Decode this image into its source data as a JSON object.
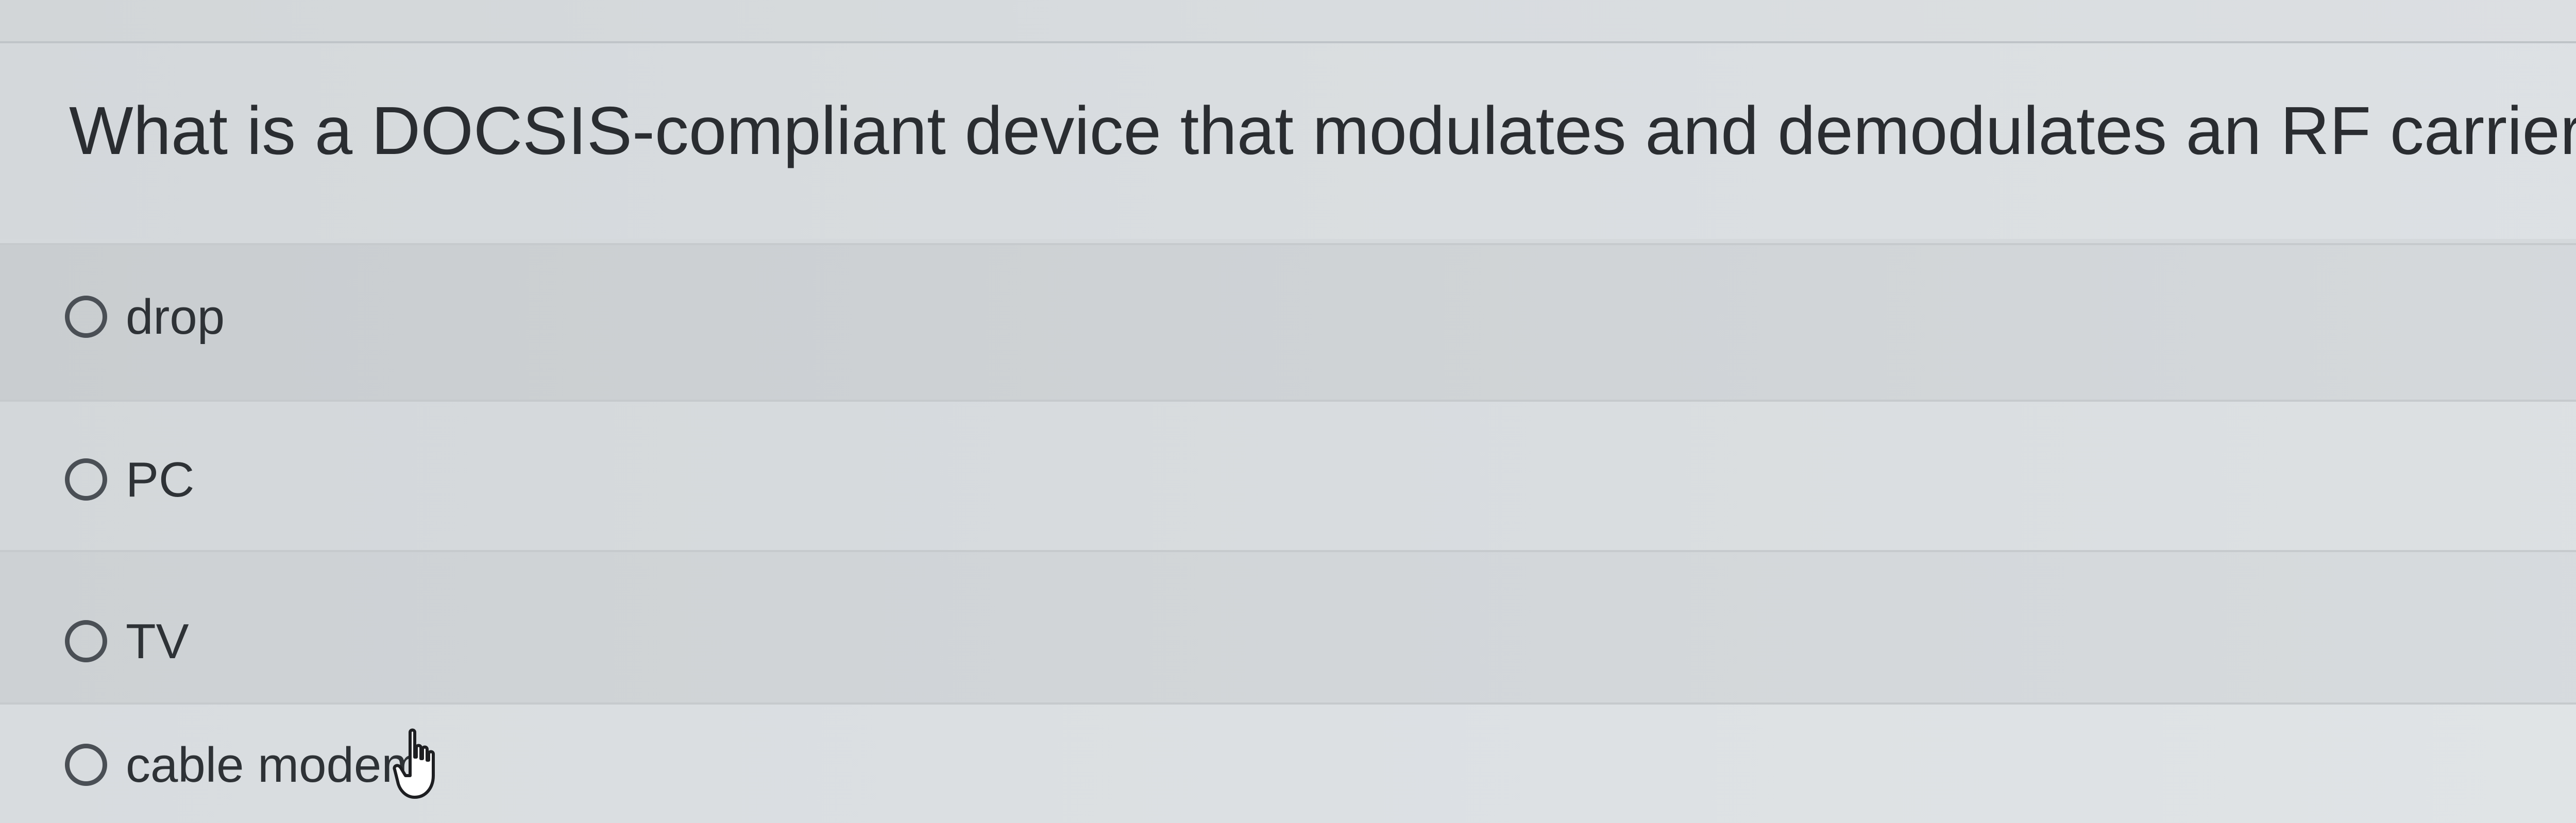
{
  "quiz": {
    "question": "What is a DOCSIS-compliant device that modulates and demodulates an RF carrier?",
    "options": [
      {
        "label": "drop",
        "selected": false
      },
      {
        "label": "PC",
        "selected": false
      },
      {
        "label": "TV",
        "selected": false
      },
      {
        "label": "cable modem",
        "selected": false
      }
    ]
  },
  "icons": {
    "radio": "radio-button-unchecked-icon",
    "cursor": "hand-pointer-cursor-icon"
  },
  "colors": {
    "background": "#d5d9dc",
    "text": "#2b2f33",
    "radio_border": "#4a4f55"
  }
}
